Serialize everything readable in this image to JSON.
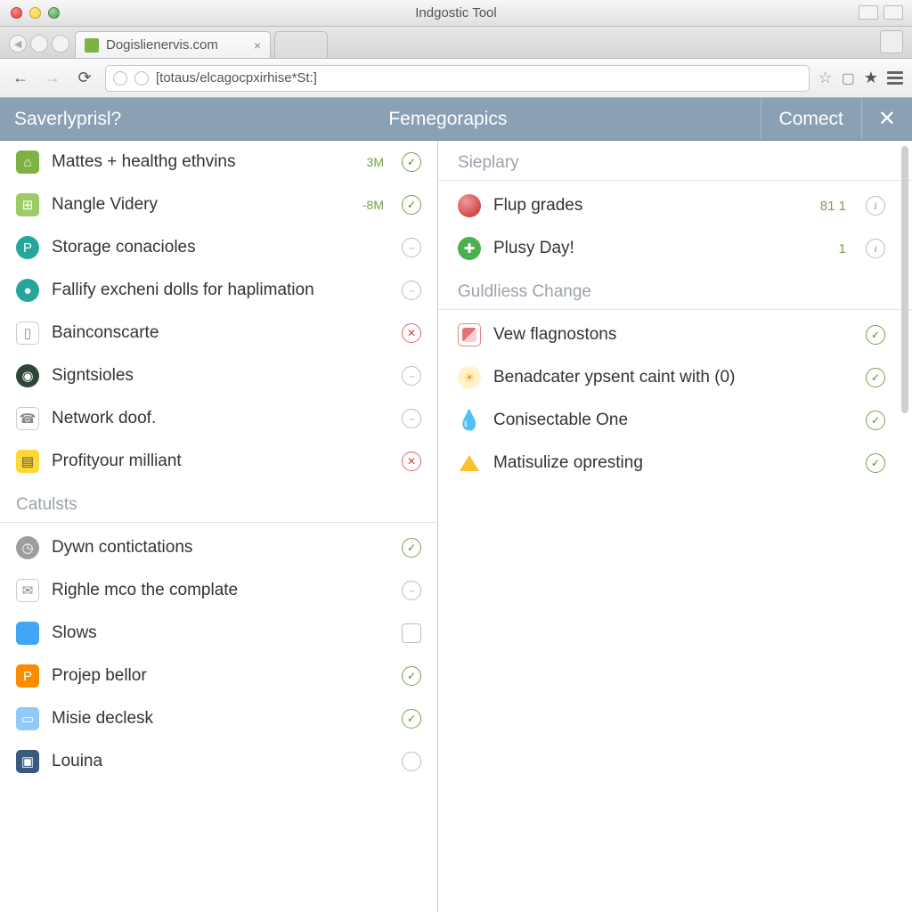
{
  "window": {
    "title": "Indgostic Tool"
  },
  "tab": {
    "label": "Dogislienervis.com"
  },
  "url": {
    "value": "[totaus/elcagocpxirhise*St:]"
  },
  "appbar": {
    "left_label": "Saverlyprisl?",
    "center_label": "Femegorapics",
    "connect_label": "Comect"
  },
  "sidebar": {
    "top_items": [
      {
        "icon": "briefcase",
        "color": "green",
        "label": "Mattes + healthg ethvins",
        "meta": "3M",
        "status": "ok"
      },
      {
        "icon": "grid",
        "color": "lime",
        "label": "Nangle Videry",
        "meta": "-8M",
        "status": "ok"
      },
      {
        "icon": "p",
        "color": "teal",
        "label": "Storage conacioles",
        "meta": "",
        "status": "dot"
      },
      {
        "icon": "dot",
        "color": "teal",
        "label": "Fallify excheni dolls for haplimation",
        "meta": "",
        "status": "dot"
      },
      {
        "icon": "battery",
        "color": "white",
        "label": "Bainconscarte",
        "meta": "",
        "status": "err"
      },
      {
        "icon": "seal",
        "color": "dark",
        "label": "Signtsioles",
        "meta": "",
        "status": "dot"
      },
      {
        "icon": "phone",
        "color": "white",
        "label": "Network doof.",
        "meta": "",
        "status": "dot"
      },
      {
        "icon": "note",
        "color": "yellow",
        "label": "Profityour milliant",
        "meta": "",
        "status": "err"
      }
    ],
    "section_label": "Catulsts",
    "bottom_items": [
      {
        "icon": "clock",
        "color": "grey",
        "label": "Dywn contictations",
        "status": "ok"
      },
      {
        "icon": "card",
        "color": "white",
        "label": "Righle mco the complate",
        "status": "dot"
      },
      {
        "icon": "monitor",
        "color": "blue",
        "label": "Slows",
        "status": "box"
      },
      {
        "icon": "pin",
        "color": "orange",
        "label": "Projep bellor",
        "status": "ok"
      },
      {
        "icon": "folder",
        "color": "ltblue",
        "label": "Misie declesk",
        "status": "ok"
      },
      {
        "icon": "app",
        "color": "navy",
        "label": "Louina",
        "status": "empty"
      }
    ]
  },
  "content": {
    "section1_label": "Sieplary",
    "section1_items": [
      {
        "icon": "red",
        "label": "Flup grades",
        "meta": "81 1",
        "status": "info"
      },
      {
        "icon": "plus",
        "label": "Plusy Day!",
        "meta": "1",
        "status": "info"
      }
    ],
    "section2_label": "Guldliess Change",
    "section2_items": [
      {
        "icon": "pill",
        "label": "Vew flagnostons",
        "status": "ok"
      },
      {
        "icon": "sun",
        "label": "Benadcater ypsent caint with (0)",
        "status": "ok"
      },
      {
        "icon": "drop",
        "label": "Conisectable One",
        "status": "ok"
      },
      {
        "icon": "tri",
        "label": "Matisulize opresting",
        "status": "ok"
      }
    ]
  }
}
